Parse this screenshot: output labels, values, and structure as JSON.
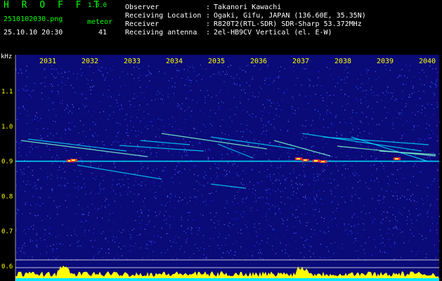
{
  "app": {
    "name": "H R O F F T",
    "version": "1.0.0"
  },
  "header": {
    "filename": "2510102030.png",
    "timestamp": "25.10.10 20:30",
    "meteor_label": "meteor",
    "meteor_count": "41"
  },
  "info": [
    {
      "key": "Observer",
      "value": "Takanori Kawachi"
    },
    {
      "key": "Receiving Location",
      "value": "Ogaki, Gifu, JAPAN (136.60E, 35.35N)"
    },
    {
      "key": "Receiver",
      "value": "R820T2(RTL-SDR) SDR-Sharp 53.372MHz"
    },
    {
      "key": "Receiving antenna",
      "value": "2el-HB9CV Vertical (el. E-W)"
    }
  ],
  "colors": {
    "green": "#00ff00",
    "yellow": "#ffff00",
    "white": "#ffffff",
    "background": "#0a0a78",
    "accent": "#00ffff"
  },
  "chart_data": {
    "type": "heatmap",
    "xlabel": "",
    "ylabel": "kHz",
    "x_ticks": [
      "2031",
      "2032",
      "2033",
      "2034",
      "2035",
      "2036",
      "2037",
      "2038",
      "2039",
      "2040"
    ],
    "y_ticks": [
      "1.1",
      "1.0",
      "0.9",
      "0.8",
      "0.7",
      "0.6"
    ],
    "ylim": [
      0.6,
      1.15
    ],
    "carrier_khz": 0.9,
    "meteor_count": 41
  }
}
